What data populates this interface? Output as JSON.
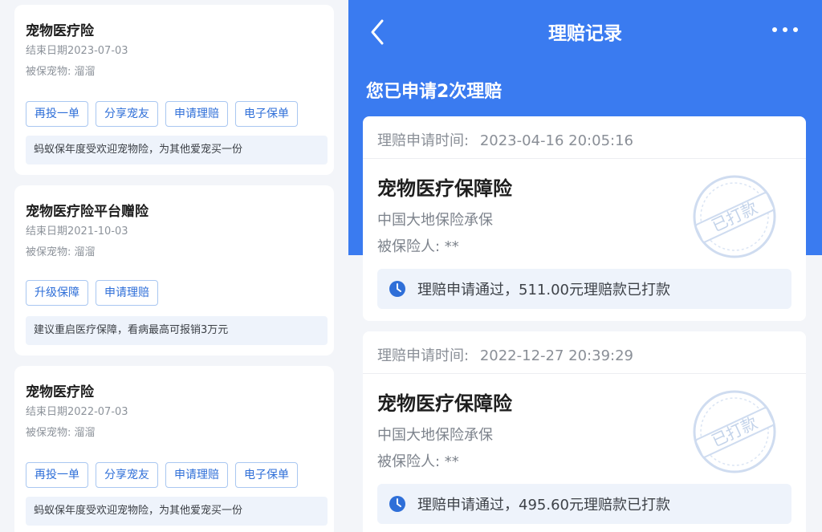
{
  "left_policies": [
    {
      "title": "宠物医疗险",
      "end_date": "结束日期2023-07-03",
      "pet": "被保宠物: 溜溜",
      "buttons": [
        "再投一单",
        "分享宠友",
        "申请理赔",
        "电子保单"
      ],
      "note": "蚂蚁保年度受欢迎宠物险，为其他爱宠买一份"
    },
    {
      "title": "宠物医疗险平台赠险",
      "end_date": "结束日期2021-10-03",
      "pet": "被保宠物: 溜溜",
      "buttons": [
        "升级保障",
        "申请理赔"
      ],
      "note": "建议重启医疗保障，看病最高可报销3万元"
    },
    {
      "title": "宠物医疗险",
      "end_date": "结束日期2022-07-03",
      "pet": "被保宠物: 溜溜",
      "buttons": [
        "再投一单",
        "分享宠友",
        "申请理赔",
        "电子保单"
      ],
      "note": "蚂蚁保年度受欢迎宠物险，为其他爱宠买一份"
    }
  ],
  "header": {
    "title": "理赔记录",
    "applied_text": "您已申请2次理赔",
    "back_icon": "chevron-left-icon",
    "more_icon": "more-dots-icon"
  },
  "claims": [
    {
      "time_label": "理赔申请时间:",
      "time": "2023-04-16 20:05:16",
      "product": "宠物医疗保障险",
      "insurer": "中国大地保险承保",
      "insured": "被保险人: **",
      "status": "理赔申请通过，511.00元理赔款已打款",
      "stamp": "已打款"
    },
    {
      "time_label": "理赔申请时间:",
      "time": "2022-12-27 20:39:29",
      "product": "宠物医疗保障险",
      "insurer": "中国大地保险承保",
      "insured": "被保险人: **",
      "status": "理赔申请通过，495.60元理赔款已打款",
      "stamp": "已打款"
    }
  ],
  "colors": {
    "header_blue": "#3a7bf0",
    "button_blue": "#2f6fd8",
    "note_bg": "#eef3fb"
  }
}
